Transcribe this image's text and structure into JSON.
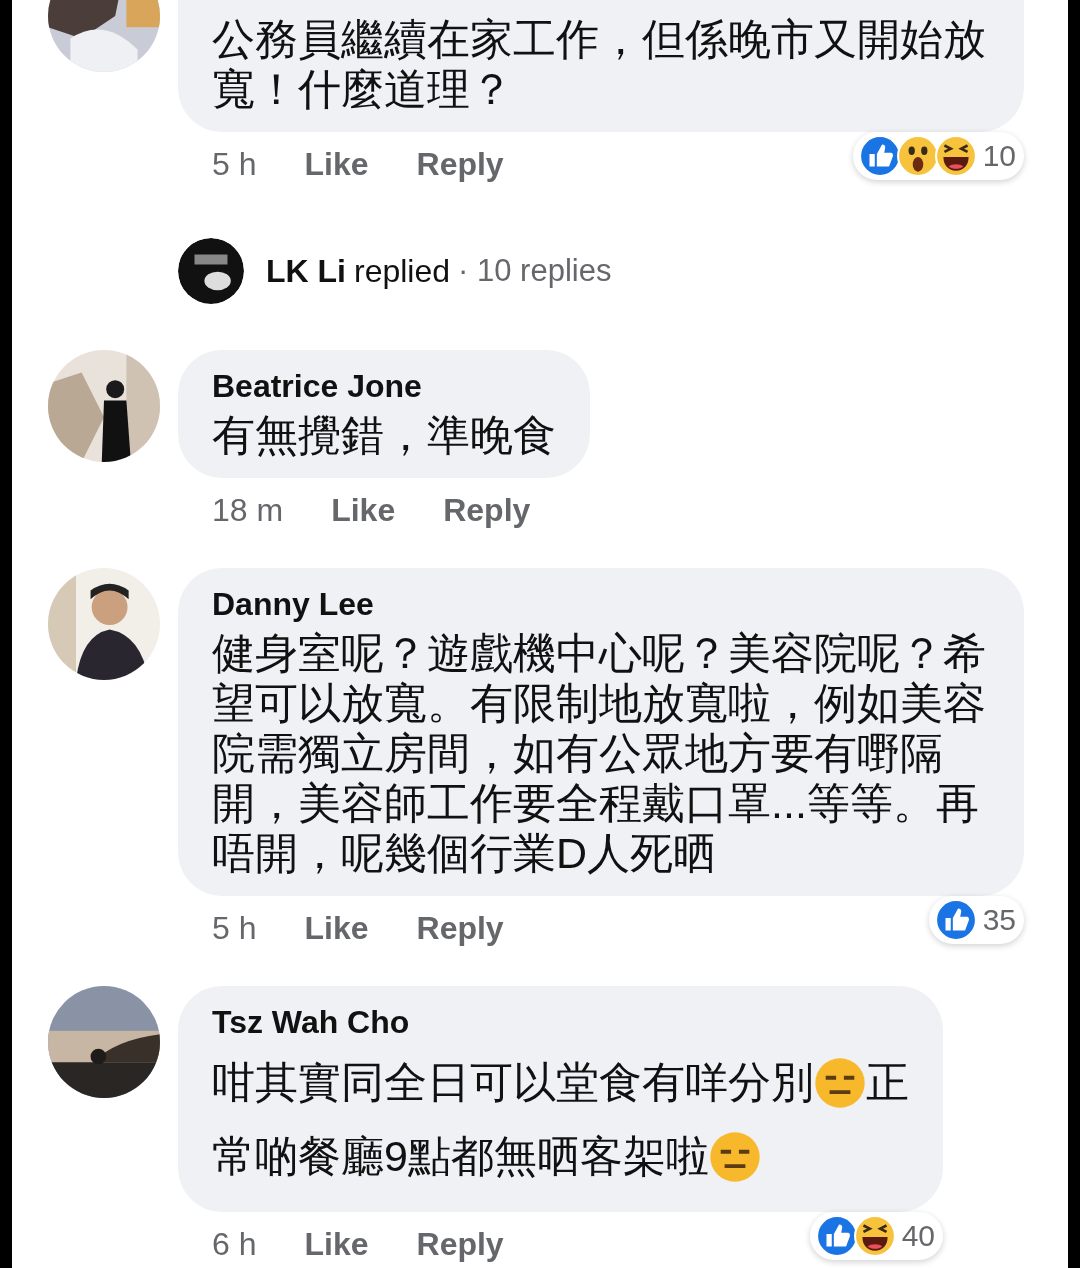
{
  "comments": [
    {
      "lines": [
        [
          {
            "kind": "text",
            "text": "公務員繼續在家工作，但係晚市又開始放寬！什麼道理？"
          }
        ]
      ],
      "time": "5 h",
      "like": "Like",
      "reply": "Reply",
      "reactions": {
        "icons": [
          {
            "kind": "like"
          },
          {
            "kind": "wow"
          },
          {
            "kind": "haha"
          }
        ],
        "count": "10"
      },
      "replies": {
        "name": "LK Li",
        "action": "replied",
        "count": "· 10 replies"
      }
    },
    {
      "author": "Beatrice Jone",
      "lines": [
        [
          {
            "kind": "text",
            "text": "有無攪錯，準晚食"
          }
        ]
      ],
      "time": "18 m",
      "like": "Like",
      "reply": "Reply"
    },
    {
      "author": "Danny Lee",
      "lines": [
        [
          {
            "kind": "text",
            "text": "健身室呢？遊戲機中心呢？美容院呢？希望可以放寬。有限制地放寬啦，例如美容院需獨立房間，如有公眾地方要有嘢隔開，美容師工作要全程戴口罩...等等。再唔開，呢幾個行業D人死晒"
          }
        ]
      ],
      "time": "5 h",
      "like": "Like",
      "reply": "Reply",
      "reactions": {
        "icons": [
          {
            "kind": "like"
          }
        ],
        "count": "35"
      }
    },
    {
      "author": "Tsz Wah Cho",
      "lines": [
        [
          {
            "kind": "text",
            "text": "咁其實同全日可以堂食有咩分別"
          },
          {
            "kind": "emoji"
          },
          {
            "kind": "text",
            "text": "正"
          }
        ],
        [
          {
            "kind": "text",
            "text": "常啲餐廳9點都無晒客架啦"
          },
          {
            "kind": "emoji"
          }
        ]
      ],
      "time": "6 h",
      "like": "Like",
      "reply": "Reply",
      "reactions": {
        "icons": [
          {
            "kind": "like"
          },
          {
            "kind": "haha"
          }
        ],
        "count": "40"
      }
    }
  ]
}
